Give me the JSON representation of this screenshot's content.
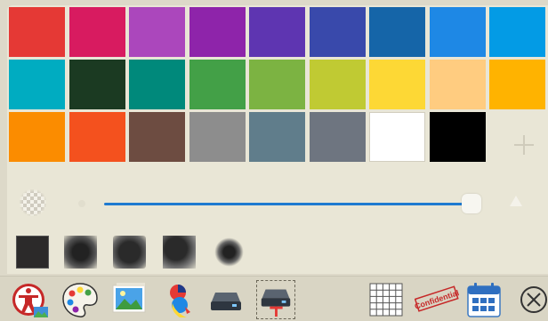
{
  "palette": {
    "rows": [
      [
        "#e53935",
        "#d81b60",
        "#ab47bc",
        "#8e24aa",
        "#5e35b1",
        "#3949ab",
        "#1565a8",
        "#1e88e5",
        "#039be5"
      ],
      [
        "#00acc1",
        "#1b3a22",
        "#00897b",
        "#43a047",
        "#7cb342",
        "#c0ca33",
        "#fdd835",
        "#ffcc80",
        "#ffb300"
      ],
      [
        "#fb8c00",
        "#f4511e",
        "#6d4c41",
        "#8d8d8d",
        "#607d8b",
        "#6e7580",
        "#ffffff",
        "#000000"
      ]
    ],
    "add_color_icon": "plus-icon"
  },
  "brush_size": {
    "level": 0.95,
    "min_icon": "small-dot-icon",
    "max_icon": "large-triangle-icon",
    "accent": "#1e7ad0"
  },
  "brush_shapes": [
    "hard-square",
    "soft-left",
    "soft-square",
    "soft-corner",
    "soft-round"
  ],
  "toolbar": {
    "selected_tool": "stamp-tool",
    "tools": [
      "accessibility-icon",
      "palette-icon",
      "picture-icon",
      "color-mixer-icon",
      "scanner-icon",
      "stamp-icon",
      "grid-icon",
      "confidential-stamp-icon",
      "calendar-icon",
      "close-icon"
    ],
    "stamp_text": "Confidential"
  }
}
